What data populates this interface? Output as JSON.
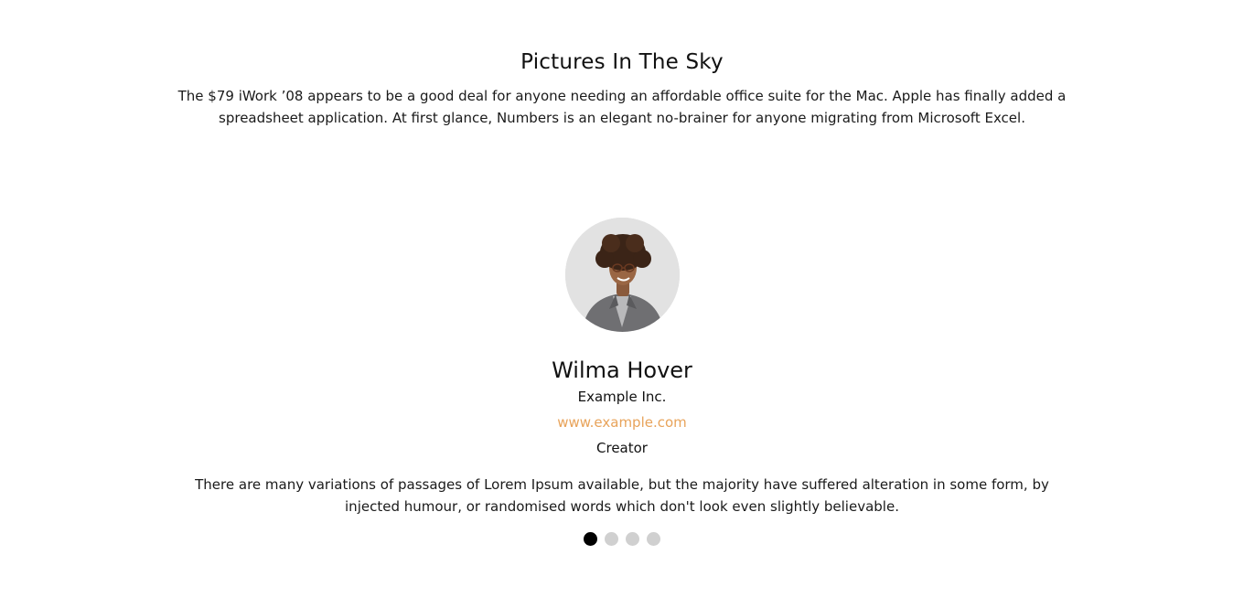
{
  "section": {
    "title": "Pictures In The Sky",
    "description": "The $79 iWork ’08 appears to be a good deal for anyone needing an affordable office suite for the Mac. Apple has finally added a spreadsheet application. At first glance, Numbers is an elegant no-brainer for anyone migrating from Microsoft Excel."
  },
  "testimonial": {
    "name": "Wilma Hover",
    "company": "Example Inc.",
    "website": "www.example.com",
    "role": "Creator",
    "quote": "There are many variations of passages of Lorem Ipsum available, but the majority have suffered alteration in some form, by injected humour, or randomised words which don't look even slightly believable."
  },
  "slider": {
    "active_index": 0,
    "count": 4
  },
  "colors": {
    "link": "#e8a35a",
    "dot_active": "#000000",
    "dot_inactive": "#d0d0d0"
  }
}
